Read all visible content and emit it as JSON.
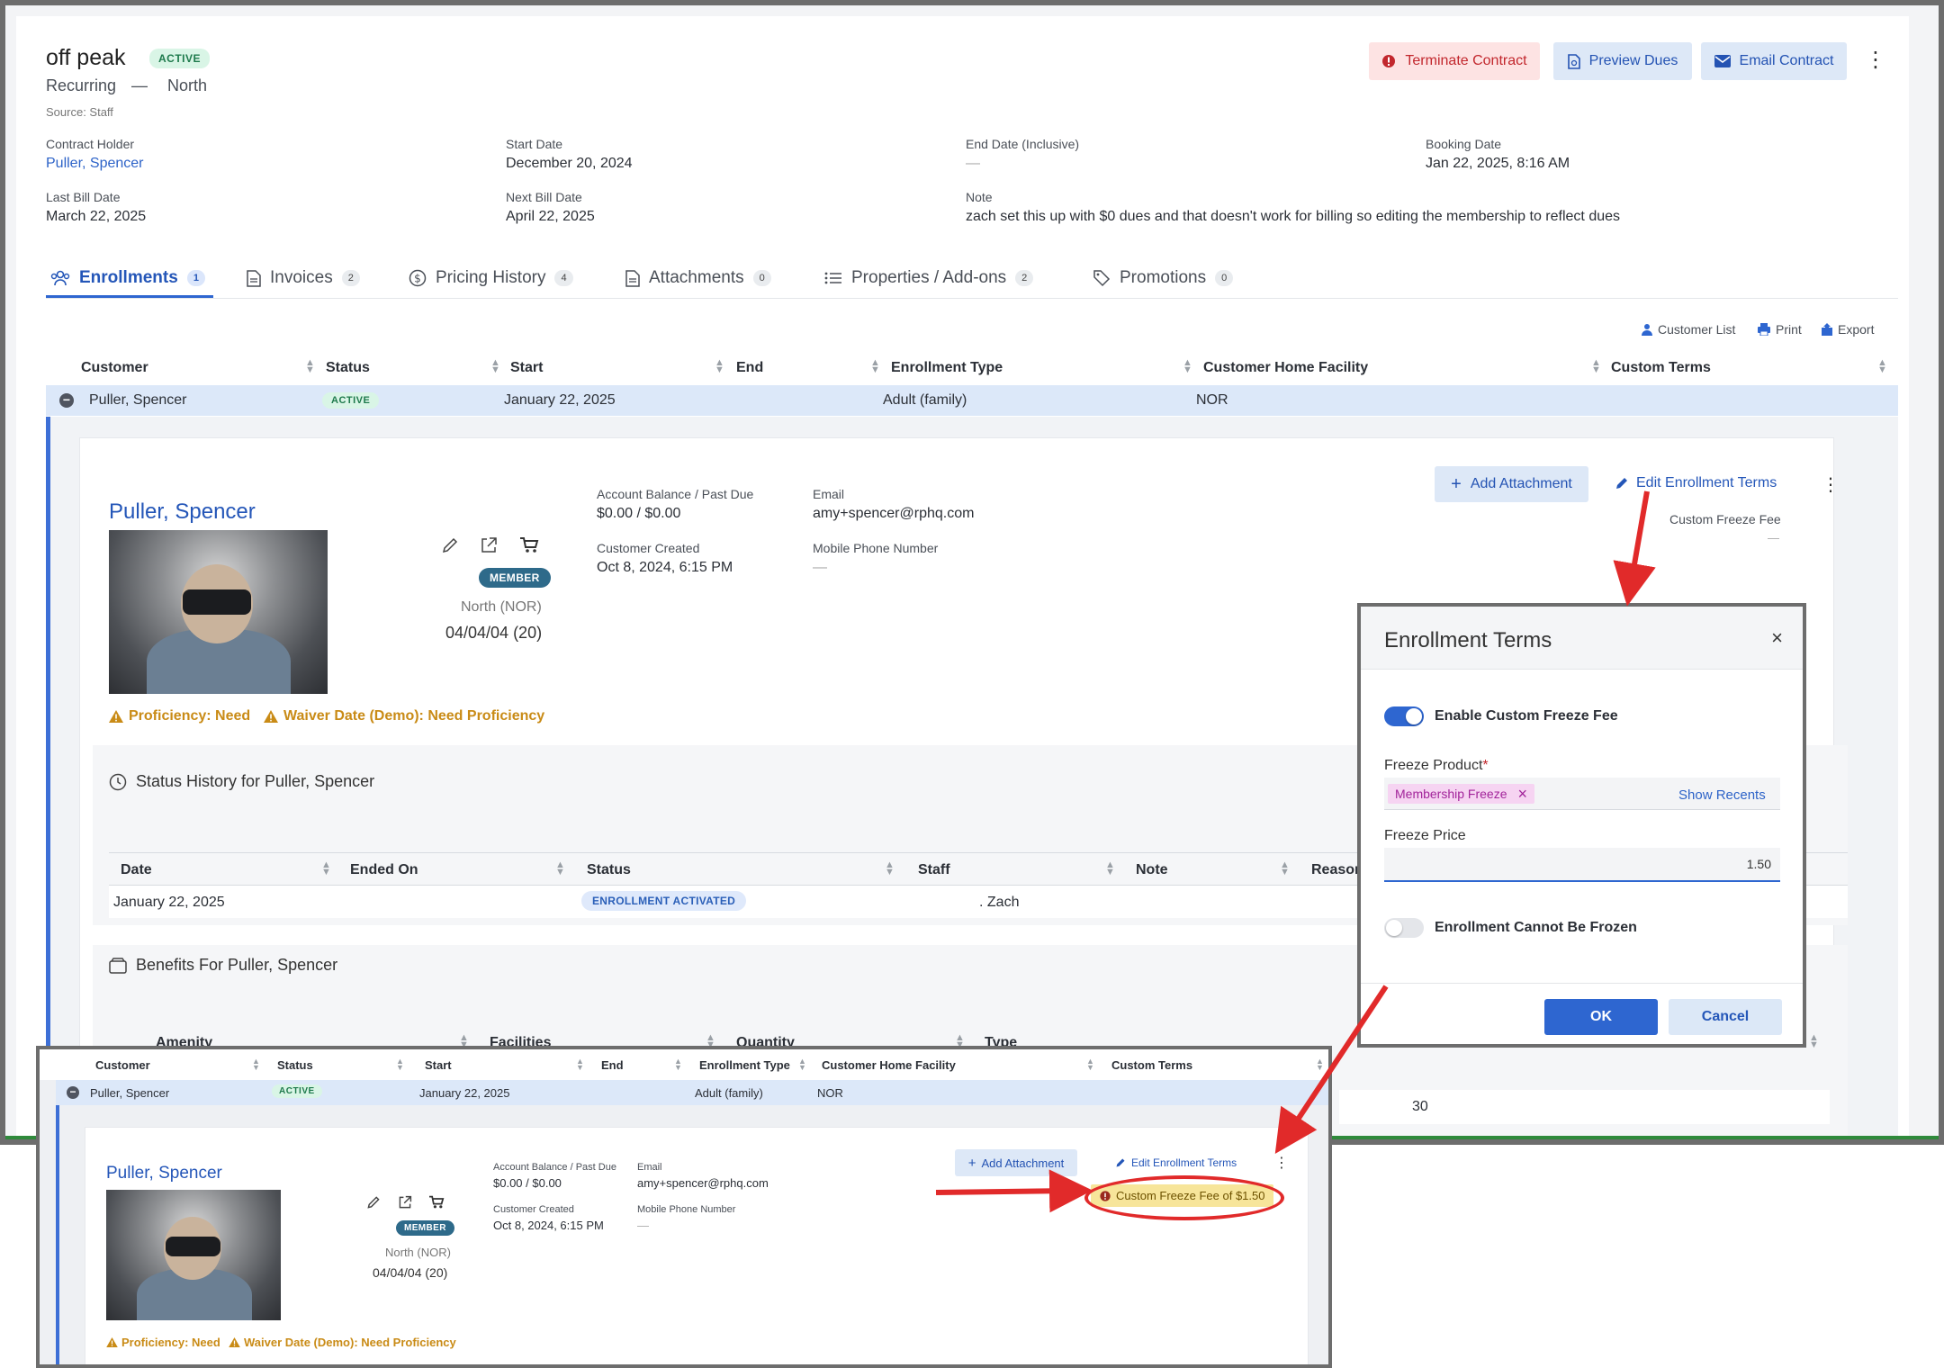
{
  "header": {
    "title": "off peak",
    "status_badge": "ACTIVE",
    "subtitle_type": "Recurring",
    "subtitle_sep": "—",
    "subtitle_location": "North",
    "source": "Source: Staff",
    "actions": {
      "terminate": "Terminate Contract",
      "preview": "Preview Dues",
      "email": "Email Contract"
    }
  },
  "info": {
    "contract_holder_label": "Contract Holder",
    "contract_holder": "Puller, Spencer",
    "start_date_label": "Start Date",
    "start_date": "December 20, 2024",
    "end_date_label": "End Date (Inclusive)",
    "end_date": "—",
    "booking_date_label": "Booking Date",
    "booking_date": "Jan 22, 2025, 8:16 AM",
    "last_bill_label": "Last Bill Date",
    "last_bill": "March 22, 2025",
    "next_bill_label": "Next Bill Date",
    "next_bill": "April 22, 2025",
    "note_label": "Note",
    "note": "zach set this up with $0 dues and that doesn't work for billing so editing the membership to reflect dues"
  },
  "tabs": [
    {
      "label": "Enrollments",
      "count": "1"
    },
    {
      "label": "Invoices",
      "count": "2"
    },
    {
      "label": "Pricing History",
      "count": "4"
    },
    {
      "label": "Attachments",
      "count": "0"
    },
    {
      "label": "Properties / Add-ons",
      "count": "2"
    },
    {
      "label": "Promotions",
      "count": "0"
    }
  ],
  "tools": {
    "customer_list": "Customer List",
    "print": "Print",
    "export": "Export"
  },
  "table": {
    "headers": [
      "Customer",
      "Status",
      "Start",
      "End",
      "Enrollment Type",
      "Customer Home Facility",
      "Custom Terms"
    ],
    "row": {
      "customer": "Puller, Spencer",
      "status": "ACTIVE",
      "start": "January 22, 2025",
      "end": "",
      "type": "Adult (family)",
      "facility": "NOR",
      "terms": ""
    }
  },
  "detail": {
    "name": "Puller, Spencer",
    "member_pill": "MEMBER",
    "facility": "North (NOR)",
    "dob": "04/04/04 (20)",
    "balance_label": "Account Balance / Past Due",
    "balance": "$0.00 / $0.00",
    "created_label": "Customer Created",
    "created": "Oct 8, 2024, 6:15 PM",
    "email_label": "Email",
    "email": "amy+spencer@rphq.com",
    "phone_label": "Mobile Phone Number",
    "phone": "—",
    "add_attachment": "Add Attachment",
    "edit_terms": "Edit Enrollment Terms",
    "custom_freeze_label": "Custom Freeze Fee",
    "custom_freeze_value": "—",
    "warn_proficiency": "Proficiency: Need",
    "warn_waiver": "Waiver Date (Demo): Need Proficiency"
  },
  "status_history": {
    "title": "Status History for Puller, Spencer",
    "headers": [
      "Date",
      "Ended On",
      "Status",
      "Staff",
      "Note",
      "Reason"
    ],
    "row": {
      "date": "January 22, 2025",
      "ended": "",
      "status": "ENROLLMENT ACTIVATED",
      "staff": ". Zach",
      "note": "",
      "reason": ""
    }
  },
  "benefits": {
    "title": "Benefits For Puller, Spencer",
    "headers": [
      "Amenity",
      "Facilities",
      "Quantity",
      "Type"
    ],
    "row_value": "30"
  },
  "modal": {
    "title": "Enrollment Terms",
    "close": "×",
    "enable_label": "Enable Custom Freeze Fee",
    "enable_on": true,
    "product_label": "Freeze Product",
    "required_mark": "*",
    "product_chip": "Membership Freeze",
    "chip_remove": "×",
    "show_recents": "Show Recents",
    "price_label": "Freeze Price",
    "price_value": "1.50",
    "cannot_freeze_label": "Enrollment Cannot Be Frozen",
    "cannot_freeze_on": false,
    "ok": "OK",
    "cancel": "Cancel"
  },
  "inset": {
    "headers": [
      "Customer",
      "Status",
      "Start",
      "End",
      "Enrollment Type",
      "Customer Home Facility",
      "Custom Terms"
    ],
    "row": {
      "customer": "Puller, Spencer",
      "status": "ACTIVE",
      "start": "January 22, 2025",
      "type": "Adult (family)",
      "facility": "NOR"
    },
    "name": "Puller, Spencer",
    "member_pill": "MEMBER",
    "facility": "North (NOR)",
    "dob": "04/04/04 (20)",
    "balance_label": "Account Balance / Past Due",
    "balance": "$0.00 / $0.00",
    "created_label": "Customer Created",
    "created": "Oct 8, 2024, 6:15 PM",
    "email_label": "Email",
    "email": "amy+spencer@rphq.com",
    "phone_label": "Mobile Phone Number",
    "phone": "—",
    "add_attachment": "Add Attachment",
    "edit_terms": "Edit Enrollment Terms",
    "freeze_badge": "Custom Freeze Fee of $1.50",
    "warn_proficiency": "Proficiency: Need",
    "warn_waiver": "Waiver Date (Demo): Need Proficiency"
  },
  "colors": {
    "accent": "#2e66d0",
    "danger": "#c2272d",
    "annotation": "#e12a2a",
    "warning": "#c98b16"
  }
}
